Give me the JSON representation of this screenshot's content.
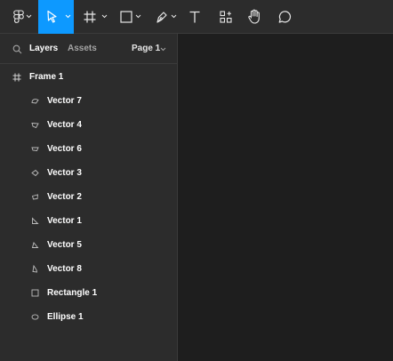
{
  "colors": {
    "accent": "#0d99ff",
    "toolbar_bg": "#2c2c2c",
    "canvas_bg": "#1e1e1e"
  },
  "toolbar": {
    "tools": [
      {
        "name": "main-menu",
        "icon": "figma-logo-icon",
        "has_dropdown": true
      },
      {
        "name": "move-tool",
        "icon": "cursor-arrow-icon",
        "has_dropdown": true,
        "active": true
      },
      {
        "name": "frame-tool",
        "icon": "frame-hash-icon",
        "has_dropdown": true
      },
      {
        "name": "shape-tool",
        "icon": "rectangle-icon",
        "has_dropdown": true
      },
      {
        "name": "pen-tool",
        "icon": "pen-nib-icon",
        "has_dropdown": true
      },
      {
        "name": "text-tool",
        "icon": "text-t-icon",
        "has_dropdown": false
      },
      {
        "name": "resources-tool",
        "icon": "components-icon",
        "has_dropdown": false
      },
      {
        "name": "hand-tool",
        "icon": "hand-icon",
        "has_dropdown": false
      },
      {
        "name": "comment-tool",
        "icon": "comment-bubble-icon",
        "has_dropdown": false
      }
    ]
  },
  "panel": {
    "tabs": {
      "layers": "Layers",
      "assets": "Assets"
    },
    "page_selector": "Page 1",
    "frame": {
      "label": "Frame 1",
      "icon": "frame-hash-icon"
    },
    "layers": [
      {
        "label": "Vector 7",
        "icon": "vector-icon"
      },
      {
        "label": "Vector 4",
        "icon": "vector-icon"
      },
      {
        "label": "Vector 6",
        "icon": "vector-icon"
      },
      {
        "label": "Vector 3",
        "icon": "vector-icon"
      },
      {
        "label": "Vector 2",
        "icon": "vector-icon"
      },
      {
        "label": "Vector 1",
        "icon": "vector-icon"
      },
      {
        "label": "Vector 5",
        "icon": "vector-icon"
      },
      {
        "label": "Vector 8",
        "icon": "vector-icon"
      },
      {
        "label": "Rectangle 1",
        "icon": "rectangle-icon"
      },
      {
        "label": "Ellipse 1",
        "icon": "ellipse-icon"
      }
    ]
  }
}
